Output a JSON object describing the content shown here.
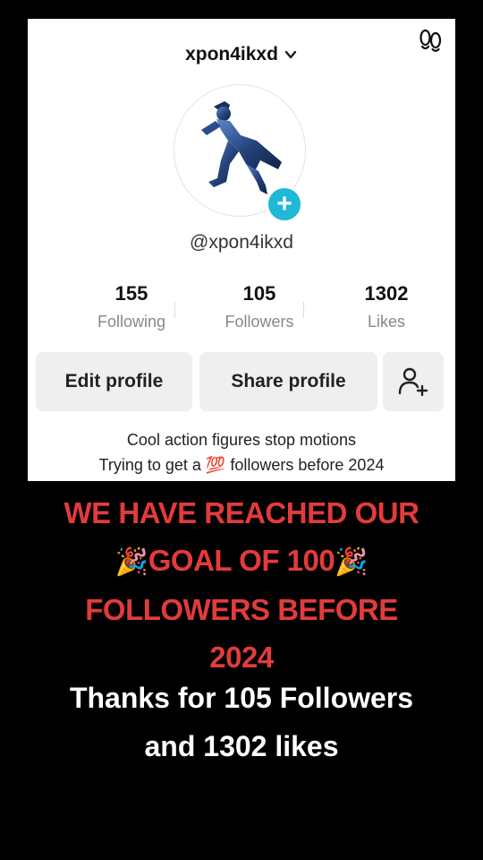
{
  "profile": {
    "username": "xpon4ikxd",
    "handle": "@xpon4ikxd",
    "stats": [
      {
        "value": "155",
        "label": "Following"
      },
      {
        "value": "105",
        "label": "Followers"
      },
      {
        "value": "1302",
        "label": "Likes"
      }
    ],
    "buttons": {
      "edit": "Edit profile",
      "share": "Share profile"
    },
    "bio": {
      "line1": "Cool action figures stop motions",
      "line2_prefix": "Trying to get a",
      "line2_emoji": "💯",
      "line2_suffix": "followers before 2024"
    }
  },
  "overlay": {
    "line1": "WE HAVE REACHED OUR",
    "popper": "🎉",
    "line2": "GOAL OF 100",
    "line3": "FOLLOWERS BEFORE",
    "line4": "2024",
    "thanks_line1": "Thanks for 105 Followers",
    "thanks_line2": "and 1302 likes"
  },
  "colors": {
    "overlay_red": "#e23b3b",
    "badge_cyan": "#1fb8d6",
    "background": "#000000"
  },
  "icons": [
    "chevron-down-icon",
    "footprint-icon",
    "add-friend-icon",
    "plus-icon"
  ]
}
